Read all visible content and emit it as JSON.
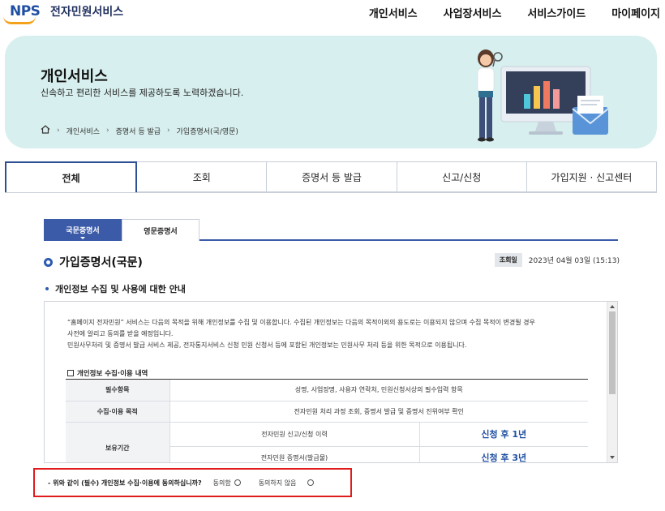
{
  "header": {
    "logo_mark": "NPS",
    "logo_text": "전자민원서비스",
    "nav": [
      "개인서비스",
      "사업장서비스",
      "서비스가이드",
      "마이페이지"
    ]
  },
  "banner": {
    "title": "개인서비스",
    "subtitle": "신속하고 편리한 서비스를 제공하도록 노력하겠습니다.",
    "breadcrumb": [
      "개인서비스",
      "증명서 등 발급",
      "가입증명서(국/영문)"
    ]
  },
  "tabs": [
    "전체",
    "조회",
    "증명서 등 발급",
    "신고/신청",
    "가입지원 · 신고센터"
  ],
  "subtabs": [
    "국문증명서",
    "영문증명서"
  ],
  "section": {
    "title": "가입증명서(국문)",
    "date_label": "조회일",
    "date_value": "2023년 04월 03일 (15:13)",
    "sub_heading": "개인정보 수집 및 사용에 대한 안내"
  },
  "notice": {
    "line1": "“홈페이지 전자민원” 서비스는 다음의 목적을 위해 개인정보를 수집 및 이용합니다. 수집된 개인정보는 다음의 목적이외의 용도로는 이용되지 않으며 수집 목적이 변경될 경우",
    "line2": "사전에 알리고 동의를 받을 예정입니다.",
    "line3": "민원사무처리 및 증명서 발급 서비스 제공, 전자통지서비스 신청 민원 신청서 등에 포함된 개인정보는 민원사무 처리 등을 위한 목적으로 이용됩니다.",
    "table_title": "개인정보 수집·이용 내역",
    "rows": {
      "required_label": "필수항목",
      "required_value": "성명, 사업장명, 사용자 연락처, 민원신청서상의 필수입력 항목",
      "purpose_label": "수집·이용 목적",
      "purpose_value": "전자민원 처리 과정 조회, 증명서 발급 및 증명서 진위여부 확인",
      "retention_label": "보유기간",
      "retention_item1": "전자민원 신고/신청 이력",
      "retention_value1": "신청 후 1년",
      "retention_item2": "전자민원 증명서(발급물)",
      "retention_value2": "신청 후 3년"
    }
  },
  "consent": {
    "question": "- 위와 같이 (필수) 개인정보 수집·이용에 동의하십니까?",
    "agree": "동의함",
    "disagree": "동의하지 않음"
  },
  "colors": {
    "accent": "#3b5ba9",
    "banner_bg": "#d7efee",
    "highlight_border": "#e01b1b"
  }
}
